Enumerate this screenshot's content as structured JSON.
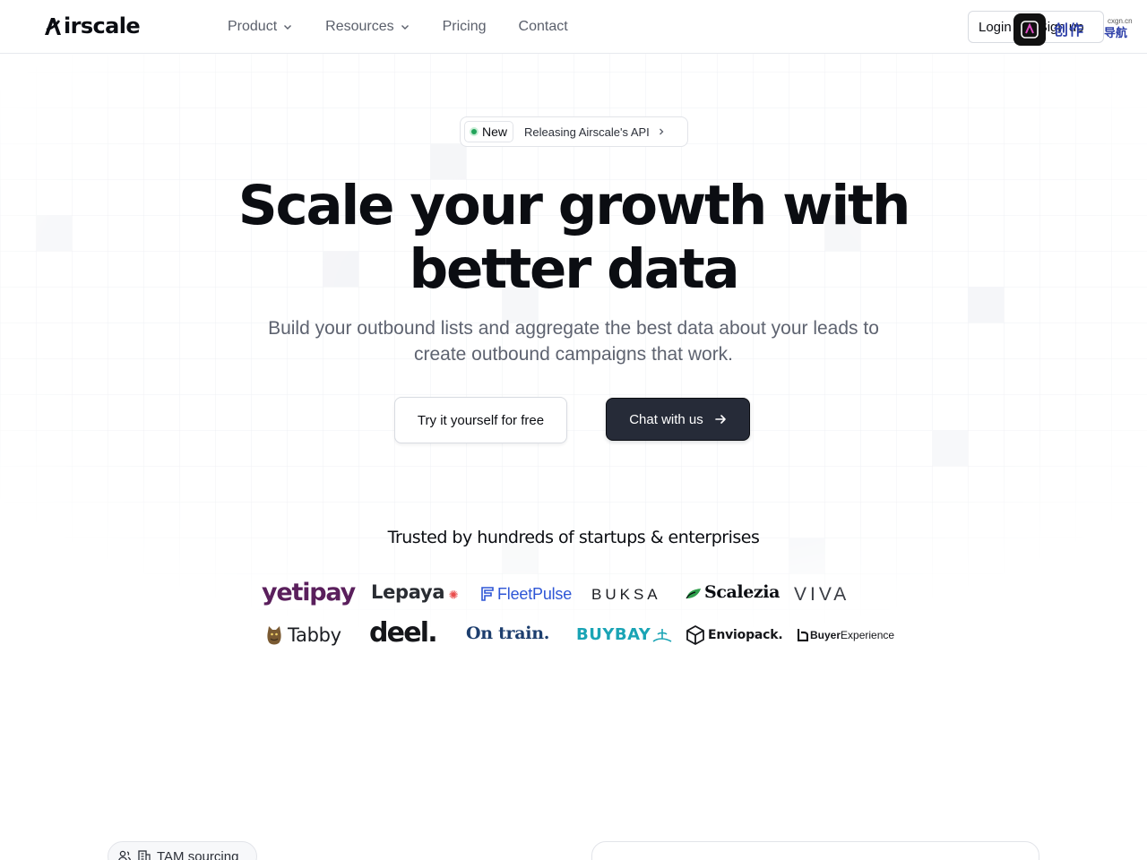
{
  "nav": {
    "brand": "irscale",
    "links": [
      {
        "label": "Product",
        "has_dropdown": true
      },
      {
        "label": "Resources",
        "has_dropdown": true
      },
      {
        "label": "Pricing",
        "has_dropdown": false
      },
      {
        "label": "Contact",
        "has_dropdown": false
      }
    ],
    "login_label": "Login",
    "signup_label": "Sign up",
    "overlay_text": "创作",
    "overlay_sub": "导航",
    "overlay_url": "cxgn.cn"
  },
  "hero": {
    "badge_new": "New",
    "badge_text": "Releasing Airscale's API",
    "title_line1": "Scale your growth with",
    "title_line2": "better data",
    "subtitle": "Build your outbound lists and aggregate the best data about your leads to create outbound campaigns that work.",
    "cta_primary": "Try it yourself for free",
    "cta_secondary": "Chat with us"
  },
  "trusted": {
    "heading": "Trusted by hundreds of startups & enterprises",
    "logos": {
      "yetipay": "yetipay",
      "lepaya": "Lepaya",
      "fleetpulse": "FleetPulse",
      "buksa": "BUKSA",
      "scalezia": "Scalezia",
      "viva": "VIVA",
      "tabby": "Tabby",
      "deel": "deel.",
      "ontrain": "On train.",
      "buybay": "BUYBAY",
      "enviopack": "Enviopack.",
      "buyer_bold": "Buyer",
      "buyer_light": "Experience"
    }
  },
  "section2": {
    "tag": "TAM sourcing"
  },
  "colors": {
    "primary_dark": "#262b38",
    "status_green": "#22a35a",
    "yetipay": "#5a1f5c",
    "lepaya_accent": "#e94c4c",
    "fleetpulse": "#2e56d6",
    "buybay": "#1aa4b5"
  }
}
